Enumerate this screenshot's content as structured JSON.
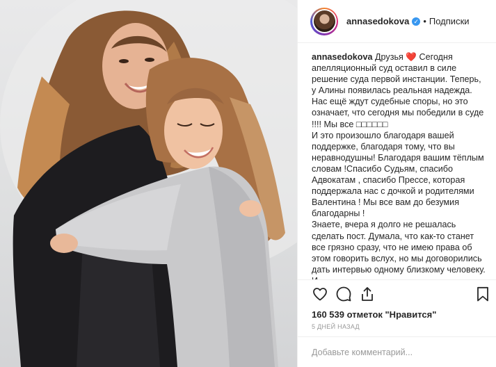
{
  "post": {
    "photo_alt": "",
    "header": {
      "username": "annasedokova",
      "separator": "•",
      "follow_label": "Подписки"
    },
    "caption": {
      "username": "annasedokova",
      "text": "Друзья ❤️ Сегодня апелляционный суд оставил в силе решение суда первой инстанции. Теперь, у Алины появилась реальная надежда. Нас ещё ждут судебные споры, но это означает, что сегодня мы победили в суде !!!! Мы все □□□□□□\nИ это произошло благодаря вашей поддержке, благодаря тому, что вы неравнодушны! Благодаря вашим тёплым словам !Спасибо Судьям, спасибо Адвокатам , спасибо Прессе, которая поддержала нас с дочкой и родителями Валентина ! Мы все вам до безумия благодарны !\nЗнаете, вчера я долго не решалась сделать пост. Думала, что как-то станет все грязно сразу, что не имею права об этом говорить вслух, но мы договорились дать интервью одному близкому человеку. И"
    },
    "likes_text": "160 539 отметок \"Нравится\"",
    "time_ago": "5 ДНЕЙ НАЗАД",
    "comment_placeholder": "Добавьте комментарий...",
    "icons": {
      "like": "heart-icon",
      "comment": "comment-icon",
      "share": "share-icon",
      "save": "bookmark-icon",
      "verified": "verified-badge-icon"
    },
    "colors": {
      "verified": "#3897f0",
      "text": "#262626",
      "muted": "#999999",
      "border": "#efefef"
    }
  }
}
